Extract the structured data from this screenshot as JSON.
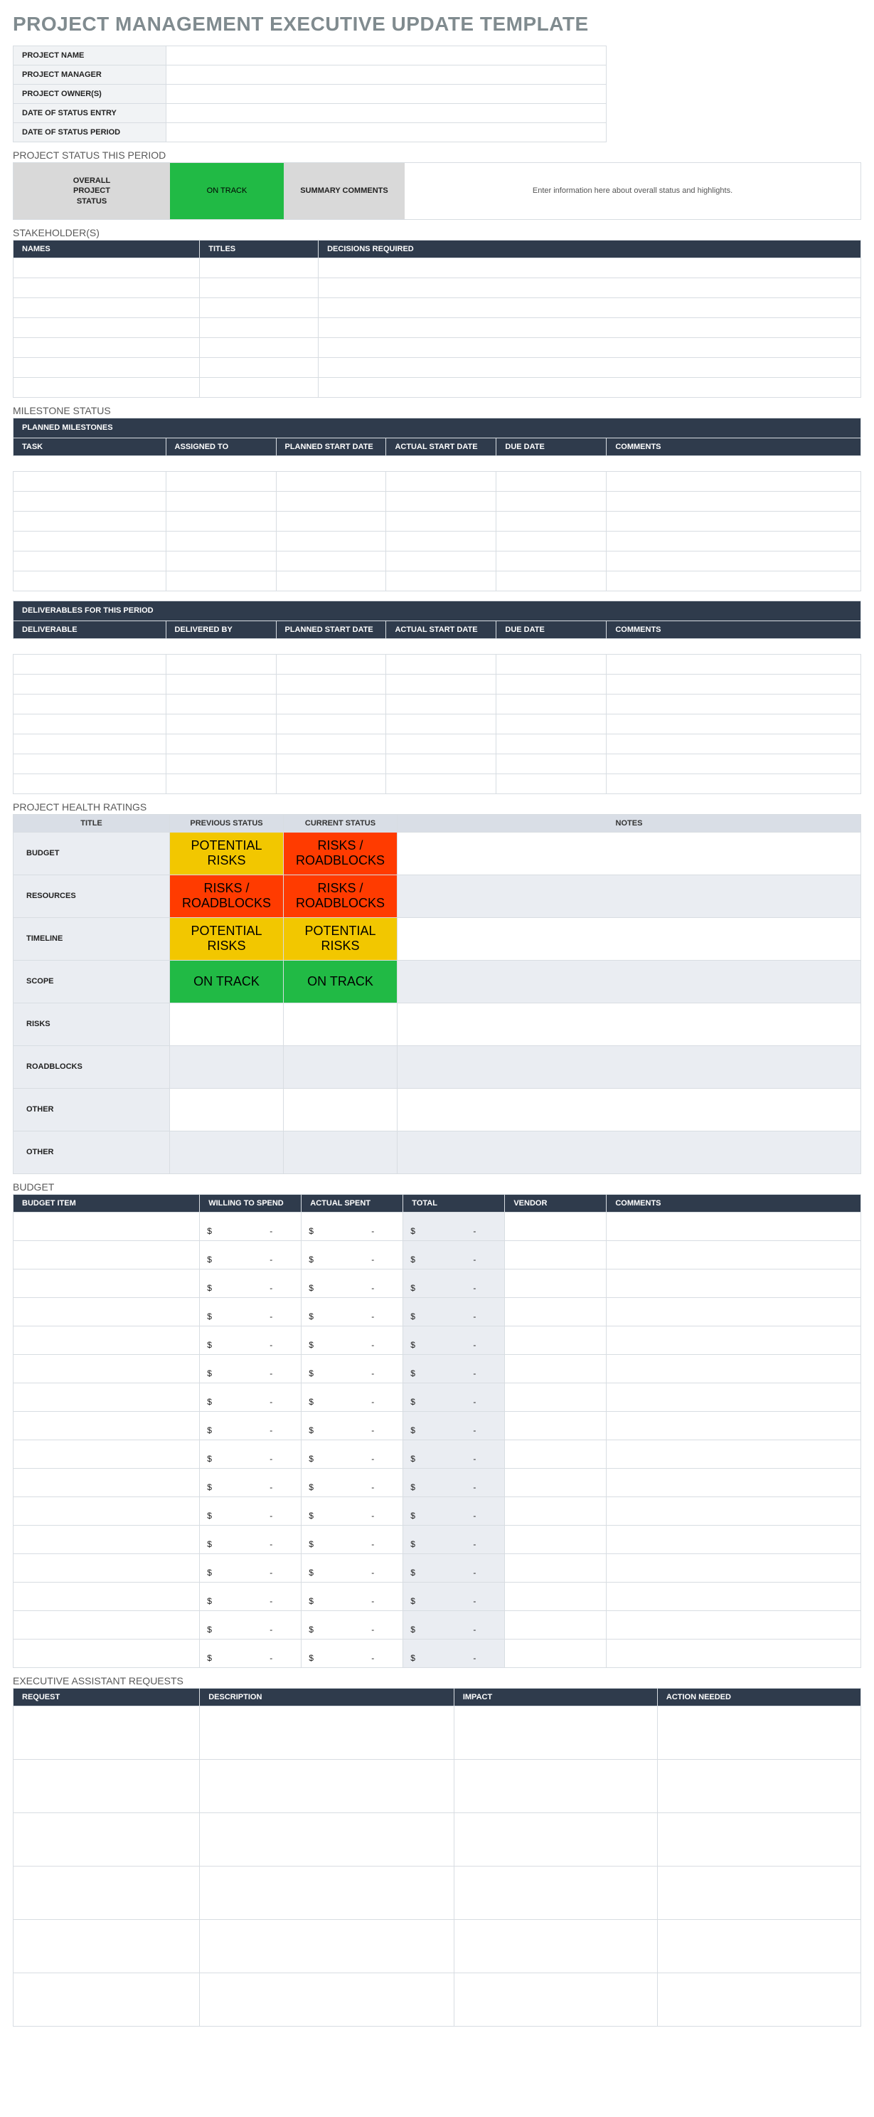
{
  "title": "PROJECT MANAGEMENT EXECUTIVE UPDATE TEMPLATE",
  "meta_labels": [
    "PROJECT NAME",
    "PROJECT MANAGER",
    "PROJECT OWNER(S)",
    "DATE OF STATUS ENTRY",
    "DATE OF STATUS PERIOD"
  ],
  "sections": {
    "status_period": "PROJECT STATUS THIS PERIOD",
    "stakeholders": "STAKEHOLDER(S)",
    "milestone": "MILESTONE STATUS",
    "health": "PROJECT HEALTH RATINGS",
    "budget": "BUDGET",
    "requests": "EXECUTIVE ASSISTANT REQUESTS"
  },
  "status_row": {
    "label1": "OVERALL\nPROJECT\nSTATUS",
    "status": "ON TRACK",
    "label2": "SUMMARY COMMENTS",
    "placeholder": "Enter information here about overall status and highlights."
  },
  "stakeholders": {
    "headers": [
      "NAMES",
      "TITLES",
      "DECISIONS REQUIRED"
    ],
    "rows": 7
  },
  "milestones": {
    "sub1": "PLANNED MILESTONES",
    "headers1": [
      "TASK",
      "ASSIGNED TO",
      "PLANNED START DATE",
      "ACTUAL START DATE",
      "DUE DATE",
      "COMMENTS"
    ],
    "rows1": 6,
    "sub2": "DELIVERABLES FOR THIS PERIOD",
    "headers2": [
      "DELIVERABLE",
      "DELIVERED BY",
      "PLANNED START DATE",
      "ACTUAL START DATE",
      "DUE DATE",
      "COMMENTS"
    ],
    "rows2": 7
  },
  "health": {
    "headers": [
      "TITLE",
      "PREVIOUS STATUS",
      "CURRENT STATUS",
      "NOTES"
    ],
    "rows": [
      {
        "label": "BUDGET",
        "prev": "POTENTIAL RISKS",
        "prev_c": "st-yellow",
        "curr": "RISKS / ROADBLOCKS",
        "curr_c": "st-red",
        "alt": false
      },
      {
        "label": "RESOURCES",
        "prev": "RISKS / ROADBLOCKS",
        "prev_c": "st-red",
        "curr": "RISKS / ROADBLOCKS",
        "curr_c": "st-red",
        "alt": true
      },
      {
        "label": "TIMELINE",
        "prev": "POTENTIAL RISKS",
        "prev_c": "st-yellow",
        "curr": "POTENTIAL RISKS",
        "curr_c": "st-yellow",
        "alt": false
      },
      {
        "label": "SCOPE",
        "prev": "ON TRACK",
        "prev_c": "st-green",
        "curr": "ON TRACK",
        "curr_c": "st-green",
        "alt": true
      },
      {
        "label": "RISKS",
        "prev": "",
        "prev_c": "",
        "curr": "",
        "curr_c": "",
        "alt": false
      },
      {
        "label": "ROADBLOCKS",
        "prev": "",
        "prev_c": "",
        "curr": "",
        "curr_c": "",
        "alt": true
      },
      {
        "label": "OTHER",
        "prev": "",
        "prev_c": "",
        "curr": "",
        "curr_c": "",
        "alt": false
      },
      {
        "label": "OTHER",
        "prev": "",
        "prev_c": "",
        "curr": "",
        "curr_c": "",
        "alt": true
      }
    ]
  },
  "budget": {
    "headers": [
      "BUDGET ITEM",
      "WILLING TO SPEND",
      "ACTUAL SPENT",
      "TOTAL",
      "VENDOR",
      "COMMENTS"
    ],
    "rows": 16
  },
  "requests": {
    "headers": [
      "REQUEST",
      "DESCRIPTION",
      "IMPACT",
      "ACTION NEEDED"
    ],
    "rows": 6
  },
  "status_values": {
    "on_track": "ON TRACK",
    "potential": "POTENTIAL RISKS",
    "risks": "RISKS / ROADBLOCKS"
  }
}
